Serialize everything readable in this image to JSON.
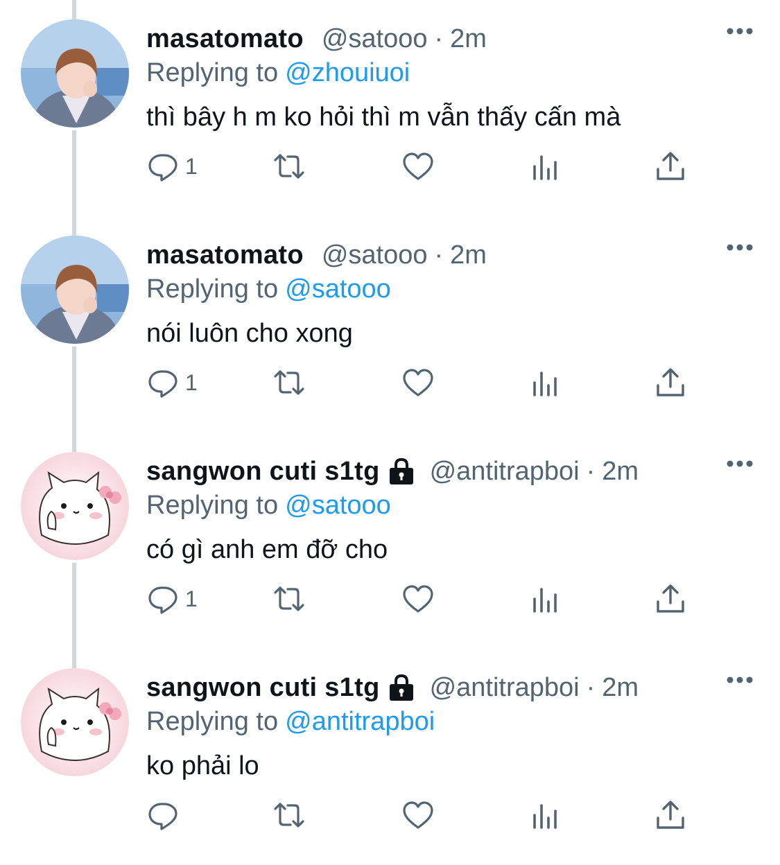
{
  "accent_color": "#1d9bf0",
  "tweets": [
    {
      "display_name": "masatomato",
      "handle": "@satooo",
      "separator": "·",
      "time": "2m",
      "locked": false,
      "avatar": "photo-avatar",
      "replying_prefix": "Replying to",
      "replying_to": "@zhouiuoi",
      "text": "thì bây h m ko hỏi thì m vẫn thấy cấn mà",
      "reply_count": "1"
    },
    {
      "display_name": "masatomato",
      "handle": "@satooo",
      "separator": "·",
      "time": "2m",
      "locked": false,
      "avatar": "photo-avatar",
      "replying_prefix": "Replying to",
      "replying_to": "@satooo",
      "text": "nói luôn cho xong",
      "reply_count": "1"
    },
    {
      "display_name": "sangwon cuti s1tg",
      "handle": "@antitrapboi",
      "separator": "·",
      "time": "2m",
      "locked": true,
      "avatar": "cat-avatar",
      "replying_prefix": "Replying to",
      "replying_to": "@satooo",
      "text": "có gì anh em đỡ cho",
      "reply_count": "1"
    },
    {
      "display_name": "sangwon cuti s1tg",
      "handle": "@antitrapboi",
      "separator": "·",
      "time": "2m",
      "locked": true,
      "avatar": "cat-avatar",
      "replying_prefix": "Replying to",
      "replying_to": "@antitrapboi",
      "text": "ko phải lo",
      "reply_count": ""
    }
  ]
}
